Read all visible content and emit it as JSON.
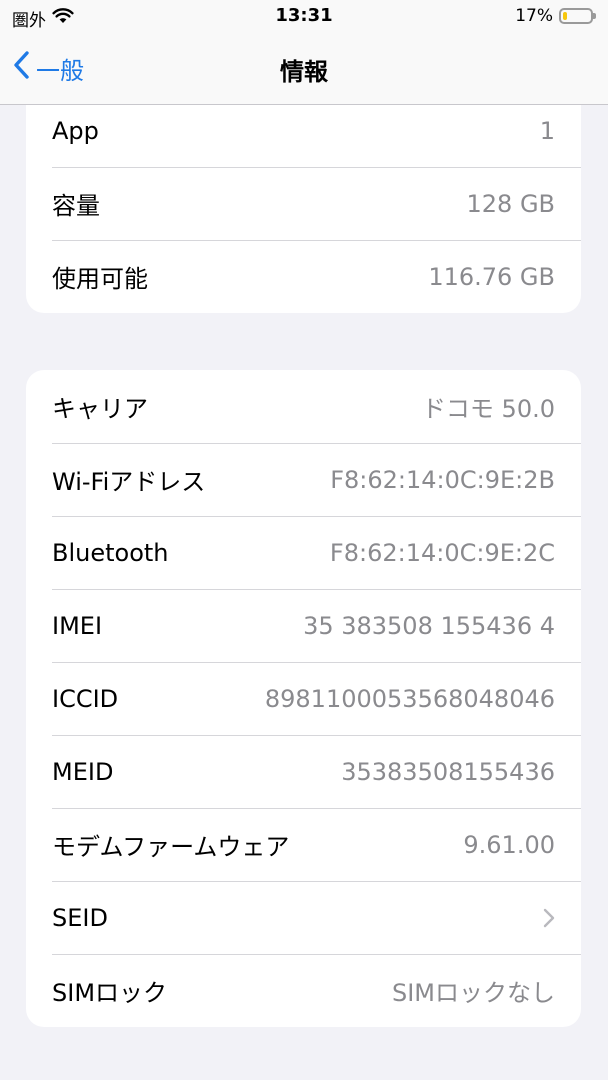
{
  "status_bar": {
    "carrier": "圏外",
    "time": "13:31",
    "battery_percent": "17%",
    "battery_level": 0.17,
    "colors": {
      "battery": "#f7c70c"
    }
  },
  "nav": {
    "back_label": "一般",
    "title": "情報",
    "colors": {
      "accent": "#1f7ae6"
    }
  },
  "group1": [
    {
      "label": "App",
      "value": "1"
    },
    {
      "label": "容量",
      "value": "128 GB"
    },
    {
      "label": "使用可能",
      "value": "116.76 GB"
    }
  ],
  "group2": [
    {
      "label": "キャリア",
      "value": "ドコモ 50.0"
    },
    {
      "label": "Wi-Fiアドレス",
      "value": "F8:62:14:0C:9E:2B"
    },
    {
      "label": "Bluetooth",
      "value": "F8:62:14:0C:9E:2C"
    },
    {
      "label": "IMEI",
      "value": "35 383508 155436 4"
    },
    {
      "label": "ICCID",
      "value": "8981100053568048046"
    },
    {
      "label": "MEID",
      "value": "35383508155436"
    },
    {
      "label": "モデムファームウェア",
      "value": "9.61.00"
    },
    {
      "label": "SEID",
      "icon": "chevron-right-icon"
    },
    {
      "label": "SIMロック",
      "value": "SIMロックなし"
    }
  ]
}
